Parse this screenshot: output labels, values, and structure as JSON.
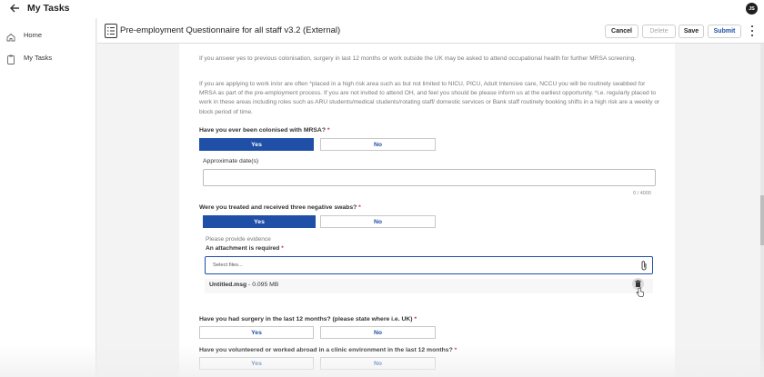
{
  "topbar": {
    "title": "My Tasks",
    "avatar_initials": "JS"
  },
  "sidebar": {
    "items": [
      {
        "label": "Home",
        "icon": "home-icon"
      },
      {
        "label": "My Tasks",
        "icon": "clipboard-icon"
      }
    ]
  },
  "form_header": {
    "title": "Pre-employment Questionnaire for all staff v3.2 (External)",
    "buttons": {
      "cancel": "Cancel",
      "delete": "Delete",
      "save": "Save",
      "submit": "Submit"
    }
  },
  "content": {
    "para1": "If you answer yes to previous colonisation, surgery in last 12 months or work outside the UK may be asked to attend occupational health for further MRSA screening.",
    "para2": "If you are applying to work in/or are often *placed in a high risk area such as but not limited to NICU, PICU, Adult Intensive care, NCCU you will be routinely swabbed for MRSA as part of the pre-employment process. If you are not invited to attend OH, and feel you should be please inform us at the earliest opportunity. *i.e. regularly placed to work in these areas including roles such as ARU students/medical students/rotating staff/ domestic services or Bank staff routinely booking shifts in a high risk are a weekly or block period of time.",
    "q1": {
      "label": "Have you ever been colonised with MRSA?",
      "yes": "Yes",
      "no": "No",
      "selected": "Yes"
    },
    "dates": {
      "label": "Approximate date(s)",
      "value": "",
      "counter": "0 / 4000"
    },
    "q2": {
      "label": "Were you treated and received three negative swabs?",
      "yes": "Yes",
      "no": "No",
      "selected": "Yes"
    },
    "evidence_note": "Please provide evidence",
    "attachment": {
      "label": "An attachment is required",
      "placeholder": "Select files...",
      "file_name": "Untitled.msg",
      "file_size": " - 0.095 MB"
    },
    "q3": {
      "label": "Have you had surgery in the last 12 months? (please state where i.e. UK)",
      "yes": "Yes",
      "no": "No"
    },
    "q4": {
      "label": "Have you volunteered or worked abroad in a clinic environment in the last 12 months?",
      "yes": "Yes",
      "no": "No"
    },
    "required_mark": "*"
  },
  "colors": {
    "primary": "#1f4fa6",
    "required": "#cc3333"
  }
}
